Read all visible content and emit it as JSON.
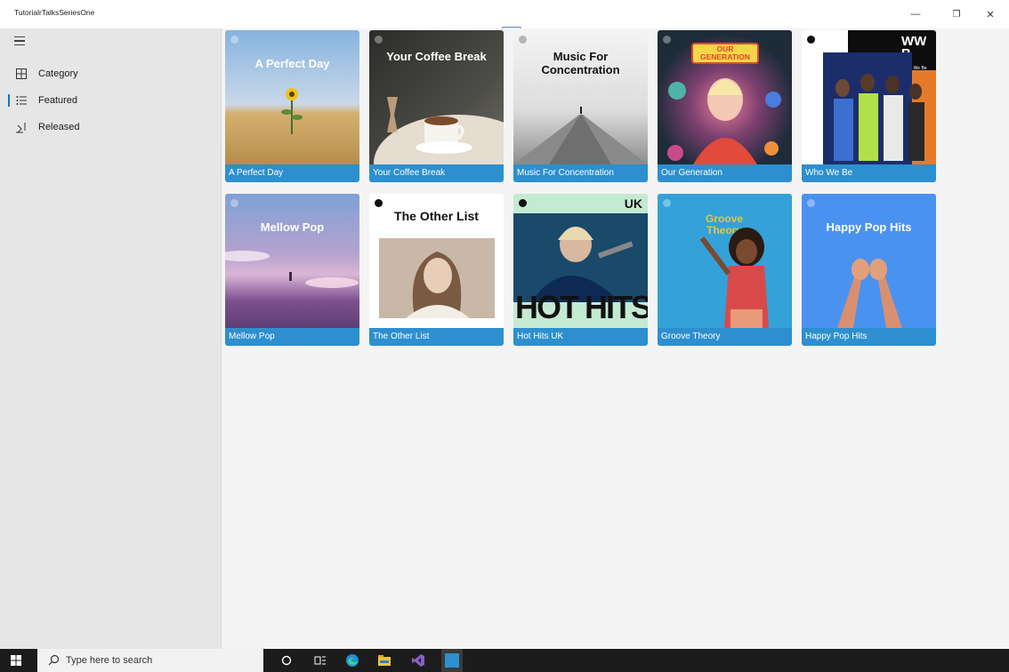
{
  "window": {
    "title": "TutorialrTalksSeriesOne",
    "minimize_glyph": "—",
    "maximize_glyph": "❐",
    "close_glyph": "✕"
  },
  "nav": {
    "items": [
      {
        "label": "Category",
        "icon": "grid-icon",
        "selected": false
      },
      {
        "label": "Featured",
        "icon": "list-icon",
        "selected": true
      },
      {
        "label": "Released",
        "icon": "download-icon",
        "selected": false
      }
    ]
  },
  "playlists": [
    {
      "caption": "A Perfect Day",
      "art_title": "A Perfect Day",
      "art_bg": "#a8c4e0",
      "accent": "#c79e55"
    },
    {
      "caption": "Your Coffee Break",
      "art_title": "Your Coffee Break",
      "art_bg": "#3a3a38",
      "accent": "#e8e2d8"
    },
    {
      "caption": "Music For Concentration",
      "art_title": "Music For Concentration",
      "art_bg": "#e6e6e6",
      "accent": "#444444"
    },
    {
      "caption": "Our Generation",
      "art_title": "OUR GENERATION",
      "art_bg": "#1e2c3a",
      "accent": "#ef7fa8"
    },
    {
      "caption": "Who We Be",
      "art_title": "WWB",
      "art_bg": "#ffffff",
      "accent": "#1b2e6b"
    },
    {
      "caption": "Mellow Pop",
      "art_title": "Mellow Pop",
      "art_bg": "#8f78b8",
      "accent": "#5f3f75"
    },
    {
      "caption": "The Other List",
      "art_title": "The Other List",
      "art_bg": "#ffffff",
      "accent": "#a58a78"
    },
    {
      "caption": "Hot Hits UK",
      "art_title": "UK",
      "art_bg": "#c4ead2",
      "accent": "#0d2a55"
    },
    {
      "caption": "Groove Theory",
      "art_title": "Groove Theory",
      "art_bg": "#34a1d9",
      "accent": "#e5c83a"
    },
    {
      "caption": "Happy Pop Hits",
      "art_title": "Happy Pop Hits",
      "art_bg": "#4a92f0",
      "accent": "#e2a07a"
    }
  ],
  "art_extra": {
    "hot_hits_text": "HOT HITS",
    "wwb_sub": "Who We Be"
  },
  "taskbar": {
    "search_placeholder": "Type here to search"
  },
  "colors": {
    "caption_bg": "#2d8fcf",
    "nav_bg": "#e6e6e6",
    "accent": "#0078d4"
  }
}
